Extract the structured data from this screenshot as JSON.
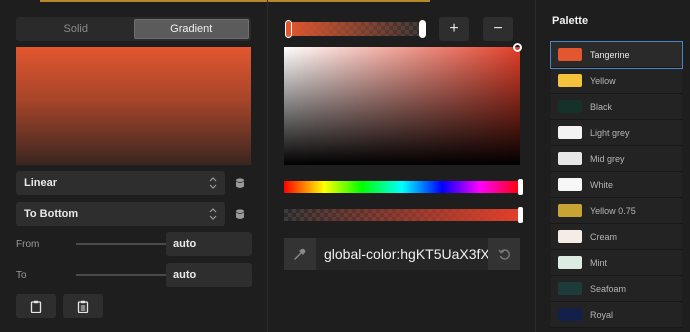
{
  "mode_tabs": [
    "Solid",
    "Gradient"
  ],
  "gradient_type": "Linear",
  "gradient_direction": "To Bottom",
  "props": {
    "from_label": "From",
    "from_value": "auto",
    "to_label": "To",
    "to_value": "auto"
  },
  "stops": {
    "add_label": "+",
    "remove_label": "−"
  },
  "color_value": "global-color:hgKT5UaX3fX",
  "palette": {
    "title": "Palette",
    "items": [
      {
        "label": "Tangerine",
        "color": "#e2572f",
        "selected": true
      },
      {
        "label": "Yellow",
        "color": "#f5c23b"
      },
      {
        "label": "Black",
        "color": "#16302a"
      },
      {
        "label": "Light grey",
        "color": "#f3f3f3"
      },
      {
        "label": "Mid grey",
        "color": "#e8e8e8"
      },
      {
        "label": "White",
        "color": "#f7f7f7"
      },
      {
        "label": "Yellow 0.75",
        "color": "#c9a435"
      },
      {
        "label": "Cream",
        "color": "#f5ece6"
      },
      {
        "label": "Mint",
        "color": "#dcece2"
      },
      {
        "label": "Seafoam",
        "color": "#1d3b3a"
      },
      {
        "label": "Royal",
        "color": "#12204a"
      }
    ]
  },
  "colors": {
    "accent": "#e2572f",
    "selection": "#4b84c4"
  }
}
